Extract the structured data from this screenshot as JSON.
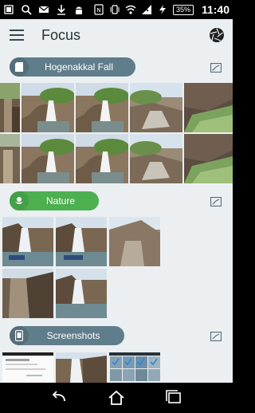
{
  "status_bar": {
    "battery": "35%",
    "time": "11:40"
  },
  "app_bar": {
    "title": "Focus"
  },
  "albums": [
    {
      "name": "Hogenakkal Fall",
      "color": "#607d8b"
    },
    {
      "name": "Nature",
      "color": "#4caf50"
    },
    {
      "name": "Screenshots",
      "color": "#607d8b"
    }
  ],
  "icons": {
    "menu": "hamburger-menu-icon",
    "aperture": "aperture-icon",
    "expand": "expand-icon",
    "back": "back-icon",
    "home": "home-icon",
    "recents": "recents-icon"
  }
}
